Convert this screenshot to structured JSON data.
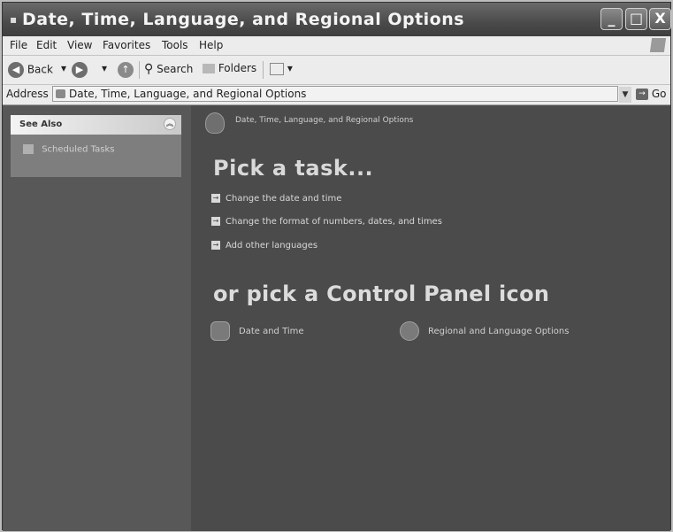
{
  "window": {
    "title": "Date, Time, Language, and Regional Options",
    "controls": {
      "minimize": "_",
      "maximize": "□",
      "close": "X"
    }
  },
  "menubar": {
    "items": [
      "File",
      "Edit",
      "View",
      "Favorites",
      "Tools",
      "Help"
    ]
  },
  "toolbar": {
    "back": "Back",
    "search": "Search",
    "folders": "Folders"
  },
  "address": {
    "label": "Address",
    "value": "Date, Time, Language, and Regional Options",
    "go": "Go"
  },
  "sidebar": {
    "see_also": "See Also",
    "links": [
      "Scheduled Tasks"
    ]
  },
  "main": {
    "category_title": "Date, Time, Language, and Regional Options",
    "pick_task": "Pick a task...",
    "tasks": [
      "Change the date and time",
      "Change the format of numbers, dates, and times",
      "Add other languages"
    ],
    "or_pick": "or pick a Control Panel icon",
    "icons": [
      "Date and Time",
      "Regional and Language Options"
    ]
  }
}
